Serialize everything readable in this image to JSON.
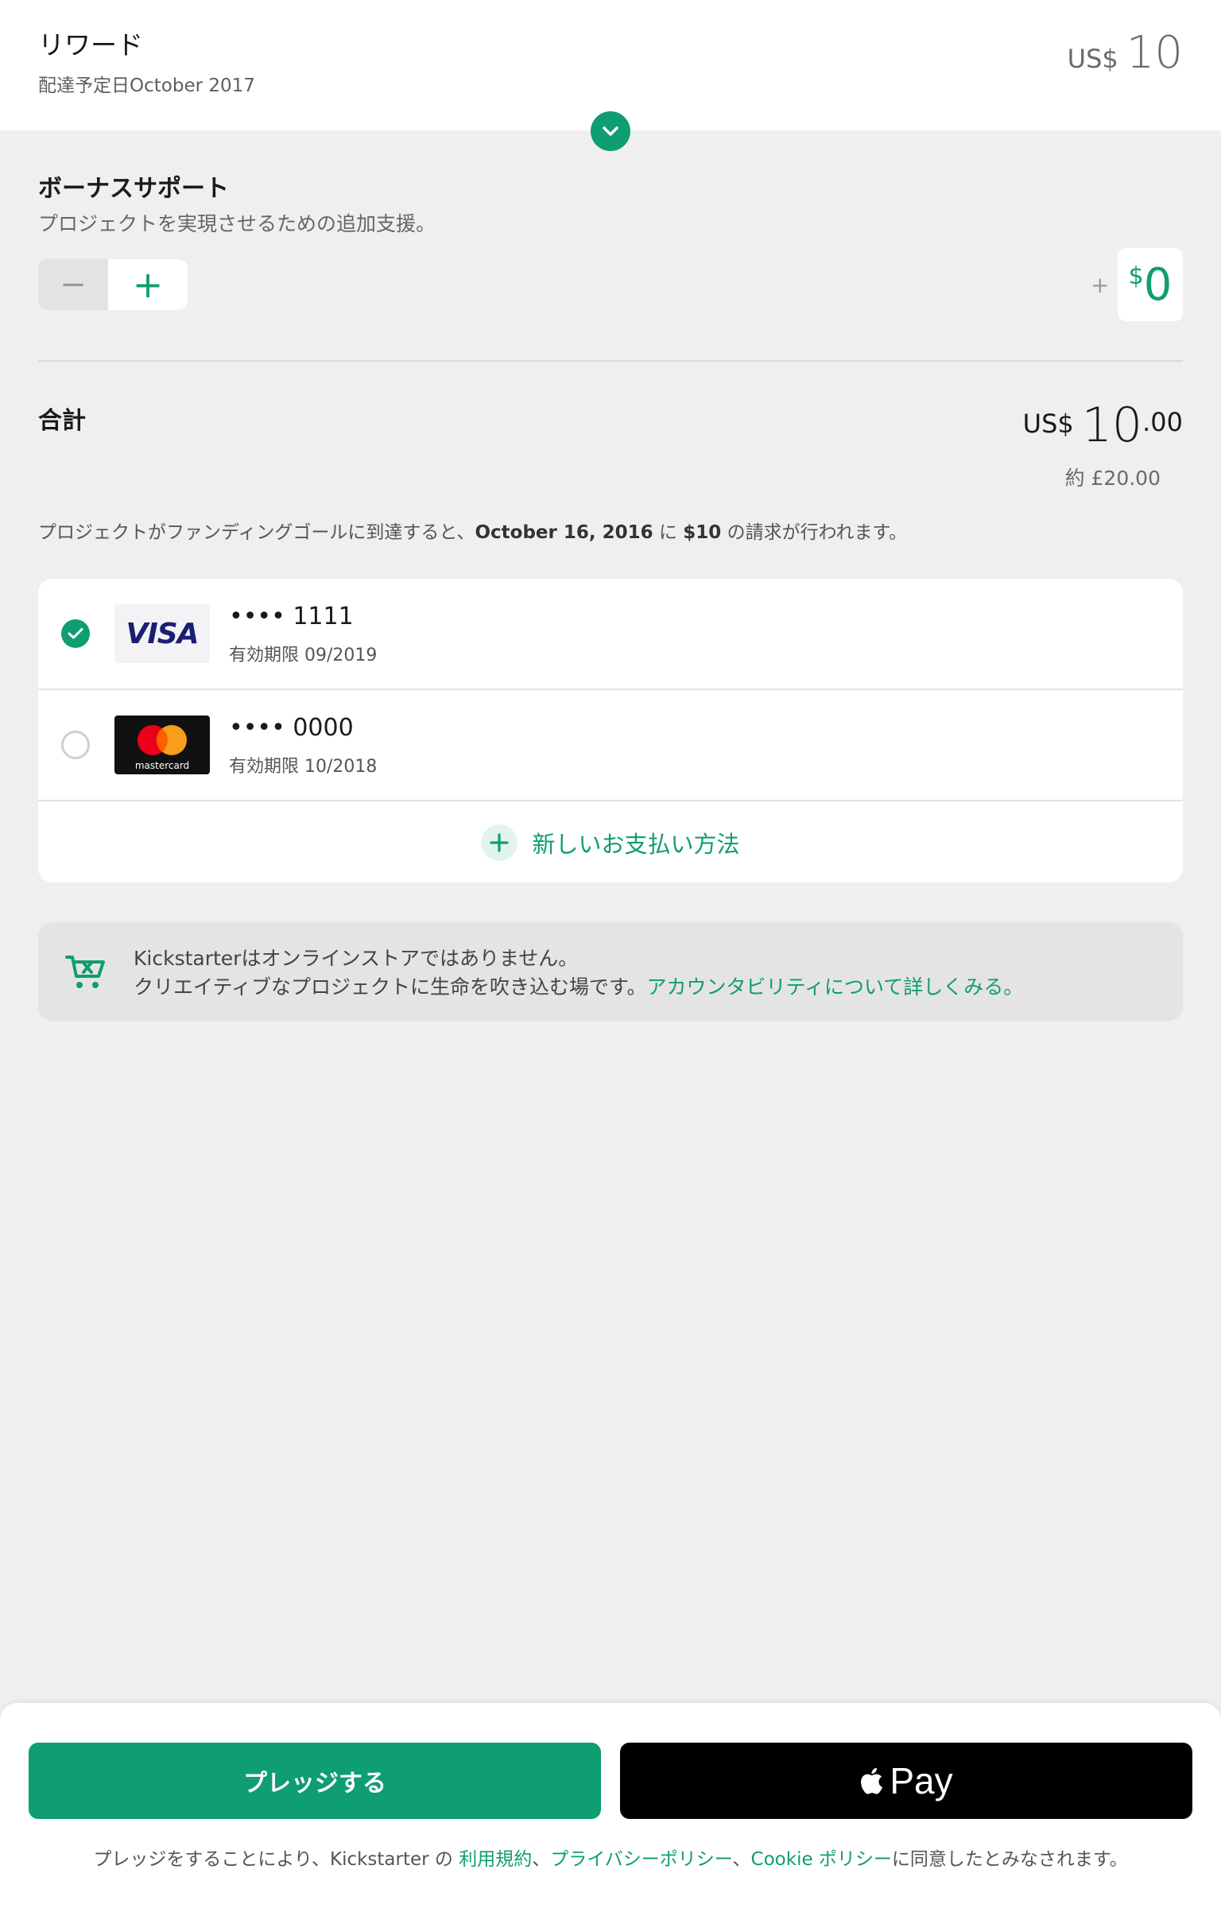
{
  "reward": {
    "title": "リワード",
    "delivery": "配達予定日October 2017",
    "currency": "US$",
    "amount": "10"
  },
  "bonus": {
    "title": "ボーナスサポート",
    "subtitle": "プロジェクトを実現させるための追加支援。",
    "minus_label": "−",
    "plus_label": "+",
    "plus_prefix": "+",
    "amount_symbol": "$",
    "amount_value": "0"
  },
  "total": {
    "label": "合計",
    "currency": "US$",
    "amount": "10",
    "decimals": ".00",
    "approx": "約 £20.00"
  },
  "charge_note": {
    "pre": "プロジェクトがファンディングゴールに到達すると、",
    "date": "October 16, 2016",
    "mid": " に ",
    "amount": "$10",
    "post": " の請求が行われます。"
  },
  "payment_methods": [
    {
      "brand": "VISA",
      "number": "•••• 1111",
      "expiry": "有効期限 09/2019",
      "selected": true
    },
    {
      "brand": "mastercard",
      "number": "•••• 0000",
      "expiry": "有効期限 10/2018",
      "selected": false
    }
  ],
  "add_method_label": "新しいお支払い方法",
  "notice": {
    "line1": "Kickstarterはオンラインストアではありません。",
    "line2_pre": "クリエイティブなプロジェクトに生命を吹き込む場です。",
    "line2_link": "アカウンタビリティについて詳しくみる。"
  },
  "footer": {
    "pledge_label": "プレッジする",
    "applepay_label": "Pay",
    "terms_pre": "プレッジをすることにより、Kickstarter の ",
    "terms_link1": "利用規約",
    "terms_sep1": "、",
    "terms_link2": "プライバシーポリシー",
    "terms_sep2": "、",
    "terms_link3": "Cookie ポリシー",
    "terms_post": "に同意したとみなされます。"
  },
  "colors": {
    "accent": "#0f9d72",
    "background": "#efefef",
    "applepay": "#000000"
  }
}
